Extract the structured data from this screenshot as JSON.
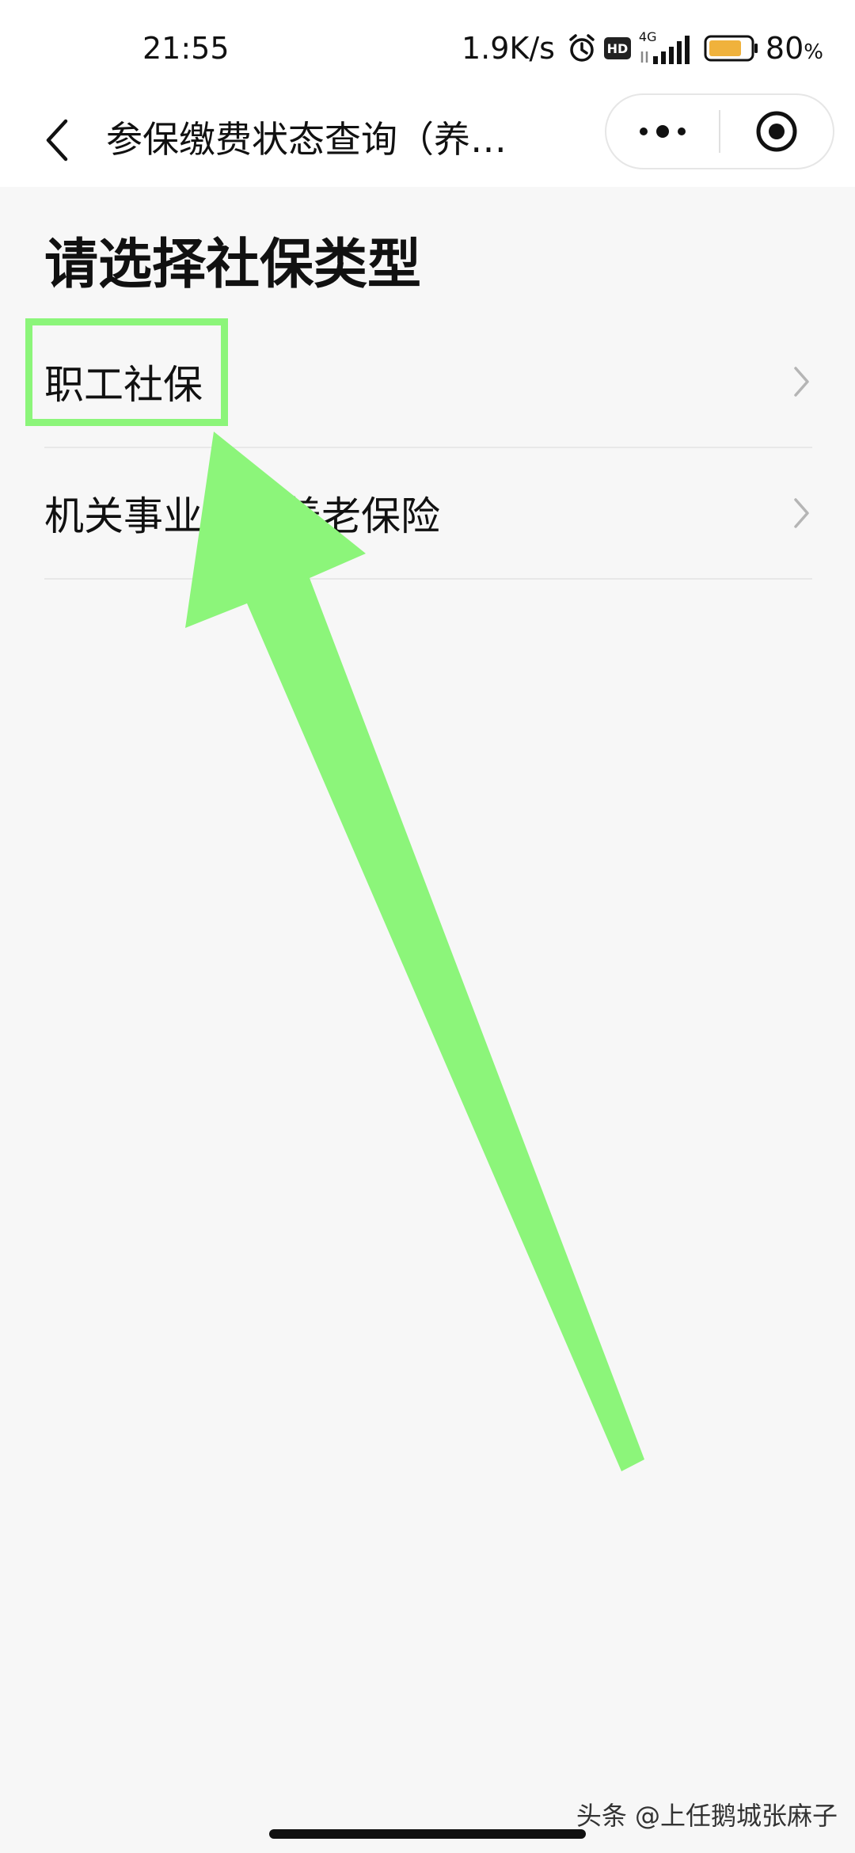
{
  "status_bar": {
    "time": "21:55",
    "net_speed": "1.9K/s",
    "network_type": "4G",
    "hd_label": "HD",
    "battery_level": "80",
    "battery_unit": "%",
    "battery_fill": 0.8,
    "battery_color": "#f0b23c",
    "icons": [
      "alarm-icon",
      "hd-icon",
      "signal-icon",
      "battery-icon"
    ]
  },
  "nav": {
    "title": "参保缴费状态查询（养…",
    "back_icon": "chevron-left-icon",
    "more_icon": "more-dots-icon",
    "close_icon": "target-circle-icon"
  },
  "main": {
    "heading": "请选择社保类型",
    "options": [
      {
        "label": "职工社保"
      },
      {
        "label": "机关事业单位养老保险"
      }
    ]
  },
  "annotation": {
    "color": "#8cf57a"
  },
  "footer": {
    "watermark": "头条 @上任鹅城张麻子"
  }
}
